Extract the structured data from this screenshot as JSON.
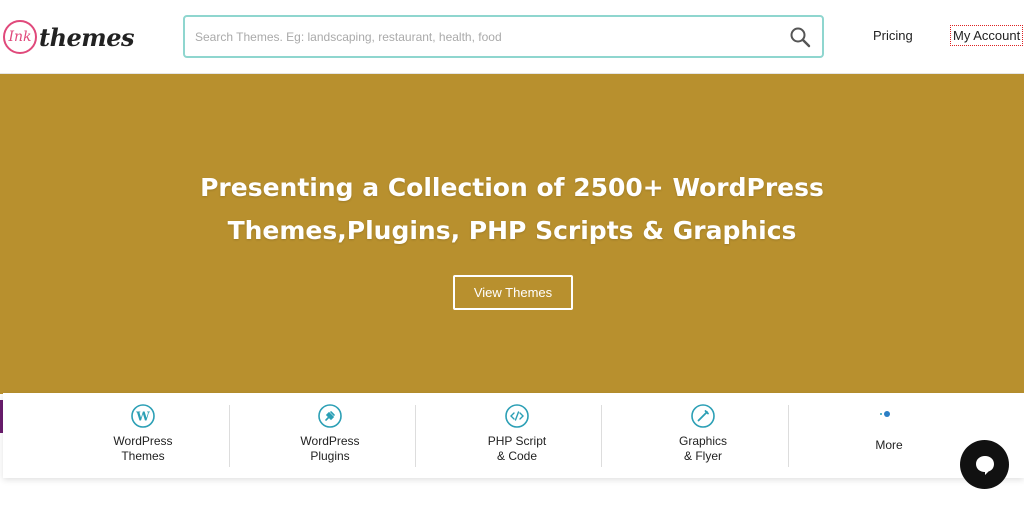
{
  "logo": {
    "badge": "Ink",
    "word": "themes"
  },
  "search": {
    "placeholder": "Search Themes. Eg: landscaping, restaurant, health, food"
  },
  "nav": {
    "pricing": "Pricing",
    "account": "My Account"
  },
  "hero": {
    "title_line1": "Presenting a Collection of 2500+ WordPress",
    "title_line2": "Themes,Plugins, PHP Scripts & Graphics",
    "button": "View Themes"
  },
  "categories": [
    {
      "line1": "WordPress",
      "line2": "Themes",
      "icon": "wordpress-icon"
    },
    {
      "line1": "WordPress",
      "line2": "Plugins",
      "icon": "plugin-icon"
    },
    {
      "line1": "PHP Script",
      "line2": "& Code",
      "icon": "code-icon"
    },
    {
      "line1": "Graphics",
      "line2": "& Flyer",
      "icon": "pen-icon"
    },
    {
      "line1": "More",
      "line2": "",
      "icon": "more-icon"
    }
  ],
  "colors": {
    "hero_bg": "#b8902e",
    "accent_teal": "#2b9fb5",
    "search_border": "#8fd6cf",
    "logo_pink": "#e0497b"
  }
}
